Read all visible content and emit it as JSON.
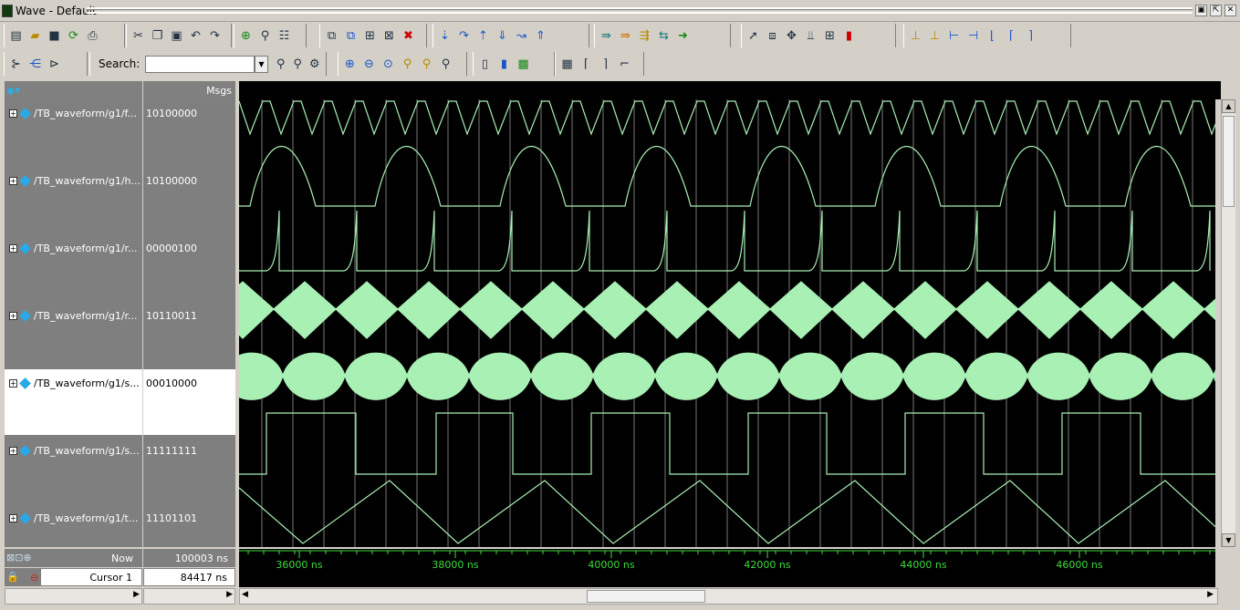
{
  "window": {
    "title": "Wave - Default"
  },
  "search": {
    "label": "Search:",
    "value": ""
  },
  "columns": {
    "msgs": "Msgs"
  },
  "signals": [
    {
      "name": "/TB_waveform/g1/f...",
      "value": "10100000",
      "selected": false
    },
    {
      "name": "/TB_waveform/g1/h...",
      "value": "10100000",
      "selected": false
    },
    {
      "name": "/TB_waveform/g1/r...",
      "value": "00000100",
      "selected": false
    },
    {
      "name": "/TB_waveform/g1/r...",
      "value": "10110011",
      "selected": false
    },
    {
      "name": "/TB_waveform/g1/s...",
      "value": "00010000",
      "selected": true
    },
    {
      "name": "/TB_waveform/g1/s...",
      "value": "11111111",
      "selected": false
    },
    {
      "name": "/TB_waveform/g1/t...",
      "value": "11101101",
      "selected": false
    }
  ],
  "status": {
    "now_label": "Now",
    "now_value": "100003 ns",
    "cursor_label": "Cursor 1",
    "cursor_value": "84417 ns"
  },
  "timeline": {
    "ticks": [
      "36000 ns",
      "38000 ns",
      "40000 ns",
      "42000 ns",
      "44000 ns",
      "46000 ns"
    ]
  },
  "colors": {
    "wave": "#a8f0b4",
    "background": "#000000",
    "panel": "#7f7f7f",
    "timeline_text": "#3ddc3d",
    "grid": "#c8c8c8"
  }
}
